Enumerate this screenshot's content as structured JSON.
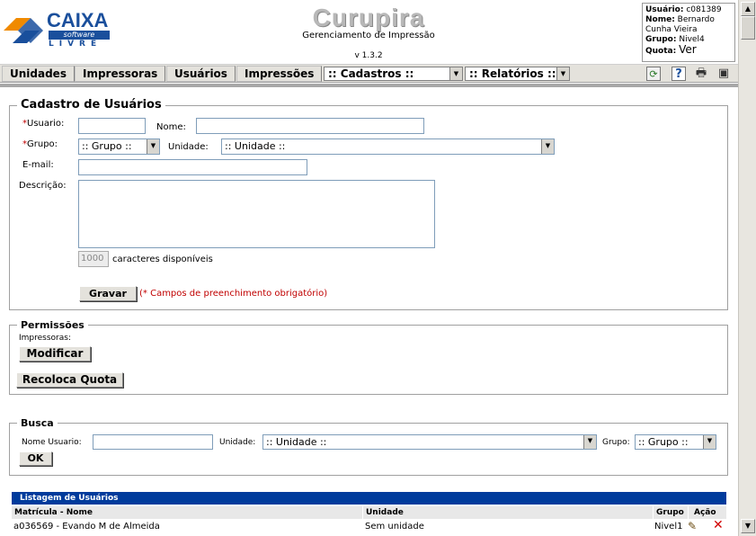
{
  "header": {
    "logo": {
      "brand": "CAIXA",
      "tagline": "software",
      "sub": "LIVRE"
    },
    "app_name": "Curupira",
    "app_subtitle": "Gerenciamento de Impressão",
    "version": "v 1.3.2",
    "user": {
      "usuario_label": "Usuário:",
      "usuario_value": "c081389",
      "nome_label": "Nome:",
      "nome_value_line1": "Bernardo",
      "nome_value_line2": "Cunha Vieira",
      "grupo_label": "Grupo:",
      "grupo_value": "Nivel4",
      "quota_label": "Quota:",
      "quota_value": "Ver"
    }
  },
  "nav": {
    "items": [
      "Unidades",
      "Impressoras",
      "Usuários",
      "Impressões"
    ],
    "cadastros": ":: Cadastros ::",
    "relatorios": ":: Relatórios ::",
    "icons": [
      "refresh-icon",
      "help-icon",
      "print-icon",
      "save-icon"
    ]
  },
  "cadastro": {
    "legend": "Cadastro de Usuários",
    "usuario_label": "Usuario:",
    "nome_label": "Nome:",
    "grupo_label": "Grupo:",
    "grupo_value": ":: Grupo ::",
    "unidade_label": "Unidade:",
    "unidade_value": ":: Unidade ::",
    "email_label": "E-mail:",
    "descricao_label": "Descrição:",
    "chars_count": "1000",
    "chars_text": "caracteres disponíveis",
    "gravar": "Gravar",
    "required_note": "(* Campos de preenchimento obrigatório)"
  },
  "permissoes": {
    "legend": "Permissões",
    "impressoras_label": "Impressoras:",
    "modificar": "Modificar",
    "recoloca": "Recoloca Quota"
  },
  "busca": {
    "legend": "Busca",
    "nome_label": "Nome Usuario:",
    "unidade_label": "Unidade:",
    "unidade_value": ":: Unidade ::",
    "grupo_label": "Grupo:",
    "grupo_value": ":: Grupo ::",
    "ok": "OK"
  },
  "listagem": {
    "title": "Listagem de Usuários",
    "columns": [
      "Matrícula - Nome",
      "Unidade",
      "Grupo",
      "Ação"
    ],
    "rows": [
      {
        "matricula_nome": "a036569 - Evando M de Almeida",
        "unidade": "Sem unidade",
        "grupo": "Nivel1"
      }
    ]
  },
  "colors": {
    "brand_blue": "#1a4f9c",
    "list_header": "#003b9c",
    "required_red": "#c00000"
  }
}
